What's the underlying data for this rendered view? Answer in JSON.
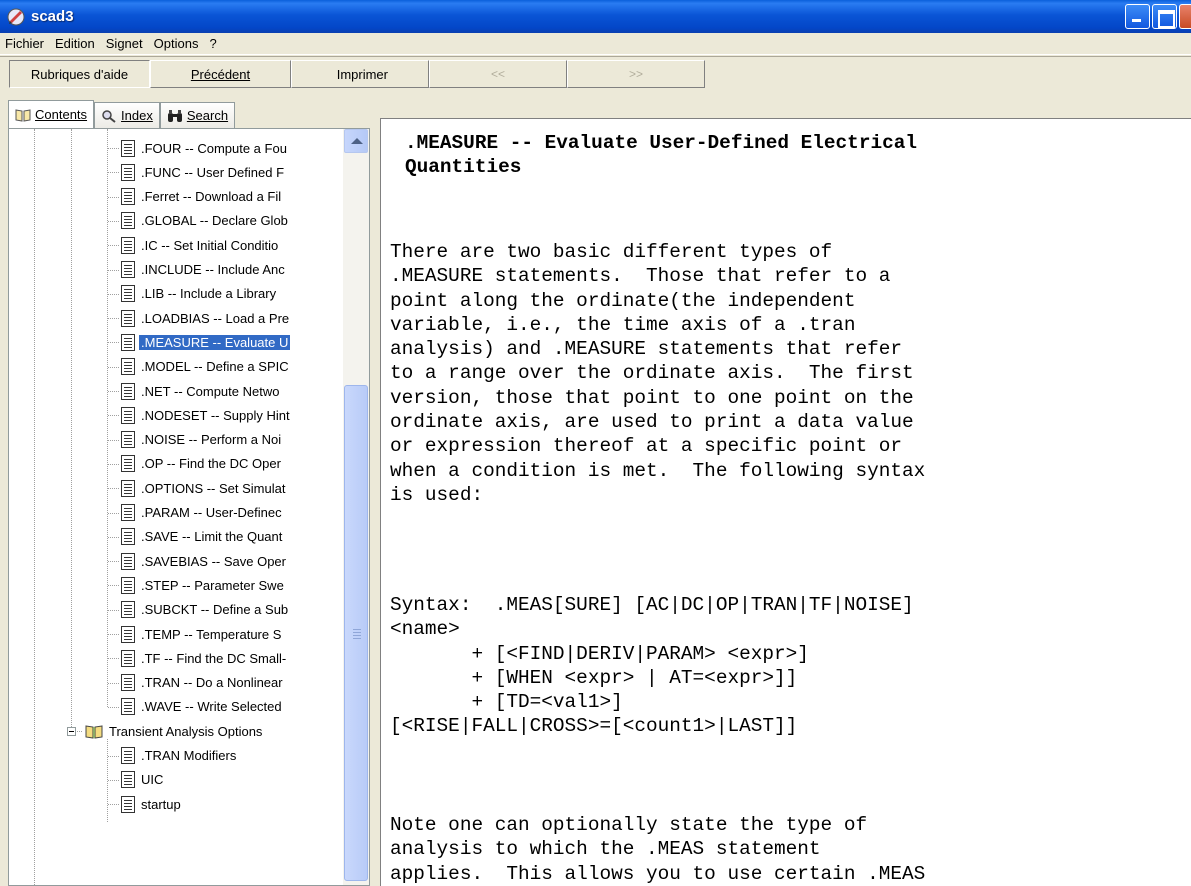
{
  "window": {
    "title": "scad3"
  },
  "menu": {
    "items": [
      "Fichier",
      "Edition",
      "Signet",
      "Options",
      "?"
    ]
  },
  "toolbar": {
    "topics": "Rubriques d'aide",
    "back": "Précédent",
    "print": "Imprimer",
    "prev": "<<",
    "next": ">>"
  },
  "tabs": {
    "contents": "Contents",
    "index": "Index",
    "search": "Search"
  },
  "tree": {
    "items": [
      ".FOUR -- Compute a Fou",
      ".FUNC -- User Defined F",
      ".Ferret -- Download a Fil",
      ".GLOBAL -- Declare Glob",
      ".IC -- Set Initial Conditio",
      ".INCLUDE -- Include Anc",
      ".LIB -- Include a Library",
      ".LOADBIAS -- Load a Pre",
      ".MEASURE -- Evaluate U",
      ".MODEL -- Define a SPIC",
      ".NET -- Compute Netwo",
      ".NODESET -- Supply Hint",
      ".NOISE -- Perform a Noi",
      ".OP -- Find the DC Oper",
      ".OPTIONS -- Set Simulat",
      ".PARAM -- User-Definec",
      ".SAVE -- Limit the Quant",
      ".SAVEBIAS -- Save Oper",
      ".STEP -- Parameter Swe",
      ".SUBCKT -- Define a Sub",
      ".TEMP -- Temperature S",
      ".TF -- Find the DC Small-",
      ".TRAN -- Do a Nonlinear",
      ".WAVE -- Write Selected"
    ],
    "selected_index": 8,
    "folder": "Transient Analysis Options",
    "sub_items": [
      ".TRAN Modifiers",
      "UIC",
      "startup"
    ]
  },
  "content": {
    "heading_lines": [
      ".MEASURE -- Evaluate User-Defined Electrical",
      "Quantities"
    ],
    "para1_lines": [
      "There are two basic different types of",
      ".MEASURE statements.  Those that refer to a",
      "point along the ordinate(the independent",
      "variable, i.e., the time axis of a .tran",
      "analysis) and .MEASURE statements that refer",
      "to a range over the ordinate axis.  The first",
      "version, those that point to one point on the",
      "ordinate axis, are used to print a data value",
      "or expression thereof at a specific point or",
      "when a condition is met.  The following syntax",
      "is used:"
    ],
    "syntax_lines": [
      "Syntax:  .MEAS[SURE] [AC|DC|OP|TRAN|TF|NOISE]",
      "<name>",
      "       + [<FIND|DERIV|PARAM> <expr>]",
      "       + [WHEN <expr> | AT=<expr>]]",
      "       + [TD=<val1>]",
      "[<RISE|FALL|CROSS>=[<count1>|LAST]]"
    ],
    "note_lines": [
      "Note one can optionally state the type of",
      "analysis to which the .MEAS statement",
      "applies.  This allows you to use certain .MEAS"
    ]
  }
}
